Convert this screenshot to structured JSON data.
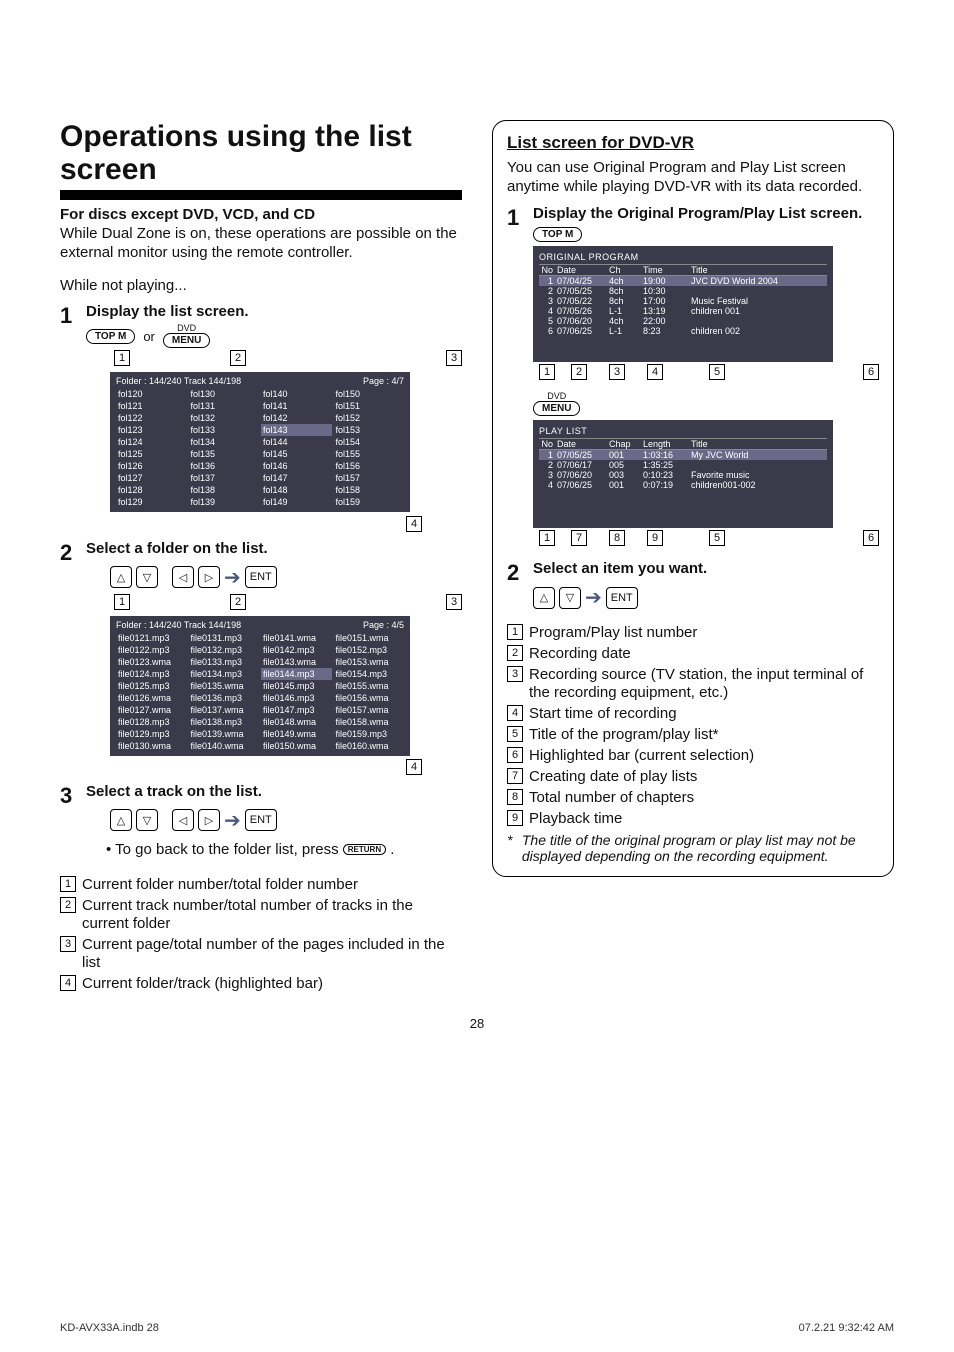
{
  "title": "Operations using the list screen",
  "left": {
    "subhead": "For discs except DVD, VCD, and CD",
    "intro": "While Dual Zone is on, these operations are possible on the external monitor using the remote controller.",
    "while": "While not playing...",
    "s1title": "Display the list screen.",
    "btn_topm": "TOP M",
    "or": "or",
    "dvd": "DVD",
    "menu": "MENU",
    "folder_header_left": "Folder : 144/240  Track 144/198",
    "page1": "Page : 4/7",
    "foldergrid": [
      [
        "fol120",
        "fol130",
        "fol140",
        "fol150"
      ],
      [
        "fol121",
        "fol131",
        "fol141",
        "fol151"
      ],
      [
        "fol122",
        "fol132",
        "fol142",
        "fol152"
      ],
      [
        "fol123",
        "fol133",
        "fol143",
        "fol153"
      ],
      [
        "fol124",
        "fol134",
        "fol144",
        "fol154"
      ],
      [
        "fol125",
        "fol135",
        "fol145",
        "fol155"
      ],
      [
        "fol126",
        "fol136",
        "fol146",
        "fol156"
      ],
      [
        "fol127",
        "fol137",
        "fol147",
        "fol157"
      ],
      [
        "fol128",
        "fol138",
        "fol148",
        "fol158"
      ],
      [
        "fol129",
        "fol139",
        "fol149",
        "fol159"
      ]
    ],
    "s2title": "Select a folder on the list.",
    "page2": "Page : 4/5",
    "filegrid": [
      [
        "file0121.mp3",
        "file0131.mp3",
        "file0141.wma",
        "file0151.wma"
      ],
      [
        "file0122.mp3",
        "file0132.mp3",
        "file0142.mp3",
        "file0152.mp3"
      ],
      [
        "file0123.wma",
        "file0133.mp3",
        "file0143.wma",
        "file0153.wma"
      ],
      [
        "file0124.mp3",
        "file0134.mp3",
        "file0144.mp3",
        "file0154.mp3"
      ],
      [
        "file0125.mp3",
        "file0135.wma",
        "file0145.mp3",
        "file0155.wma"
      ],
      [
        "file0126.wma",
        "file0136.mp3",
        "file0146.mp3",
        "file0156.wma"
      ],
      [
        "file0127.wma",
        "file0137.wma",
        "file0147.mp3",
        "file0157.wma"
      ],
      [
        "file0128.mp3",
        "file0138.mp3",
        "file0148.wma",
        "file0158.wma"
      ],
      [
        "file0129.mp3",
        "file0139.wma",
        "file0149.wma",
        "file0159.mp3"
      ],
      [
        "file0130.wma",
        "file0140.wma",
        "file0150.wma",
        "file0160.wma"
      ]
    ],
    "s3title": "Select a track on the list.",
    "goback": "To go back to the folder list, press",
    "return": "RETURN",
    "ent": "ENT",
    "legend": [
      "Current folder number/total folder number",
      "Current track number/total number of tracks in the current folder",
      "Current page/total number of the pages included in the list",
      "Current folder/track (highlighted bar)"
    ]
  },
  "right": {
    "heading": "List screen for DVD-VR",
    "intro": "You can use Original Program and Play List screen anytime while playing DVD-VR with its data recorded.",
    "s1title": "Display the Original Program/Play List screen.",
    "btn_topm": "TOP M",
    "originalprogram": "ORIGINAL PROGRAM",
    "op_headers": {
      "no": "No",
      "date": "Date",
      "ch": "Ch",
      "time": "Time",
      "title": "Title"
    },
    "op_rows": [
      {
        "no": "1",
        "date": "07/04/25",
        "ch": "4ch",
        "time": "19:00",
        "title": "JVC DVD World 2004"
      },
      {
        "no": "2",
        "date": "07/05/25",
        "ch": "8ch",
        "time": "10:30",
        "title": ""
      },
      {
        "no": "3",
        "date": "07/05/22",
        "ch": "8ch",
        "time": "17:00",
        "title": "Music Festival"
      },
      {
        "no": "4",
        "date": "07/05/26",
        "ch": "L-1",
        "time": "13:19",
        "title": "children 001"
      },
      {
        "no": "5",
        "date": "07/06/20",
        "ch": "4ch",
        "time": "22:00",
        "title": ""
      },
      {
        "no": "6",
        "date": "07/06/25",
        "ch": "L-1",
        "time": "8:23",
        "title": "children 002"
      }
    ],
    "dvd": "DVD",
    "menu": "MENU",
    "playlist": "PLAY LIST",
    "pl_headers": {
      "no": "No",
      "date": "Date",
      "chap": "Chap",
      "length": "Length",
      "title": "Title"
    },
    "pl_rows": [
      {
        "no": "1",
        "date": "07/05/25",
        "chap": "001",
        "length": "1:03:16",
        "title": "My JVC World"
      },
      {
        "no": "2",
        "date": "07/06/17",
        "chap": "005",
        "length": "1:35:25",
        "title": ""
      },
      {
        "no": "3",
        "date": "07/06/20",
        "chap": "003",
        "length": "0:10:23",
        "title": "Favorite music"
      },
      {
        "no": "4",
        "date": "07/06/25",
        "chap": "001",
        "length": "0:07:19",
        "title": "children001-002"
      }
    ],
    "s2title": "Select an item you want.",
    "ent": "ENT",
    "legend": [
      "Program/Play list number",
      "Recording date",
      "Recording source (TV station, the input terminal of the recording equipment, etc.)",
      "Start time of recording",
      "Title of the program/play list*",
      "Highlighted bar (current selection)",
      "Creating date of play lists",
      "Total number of chapters",
      "Playback time"
    ],
    "asterisk": "The title of the original program or play list may not be displayed depending on the recording equipment."
  },
  "pagenum": "28",
  "footer_left": "KD-AVX33A.indb   28",
  "footer_right": "07.2.21   9:32:42 AM"
}
